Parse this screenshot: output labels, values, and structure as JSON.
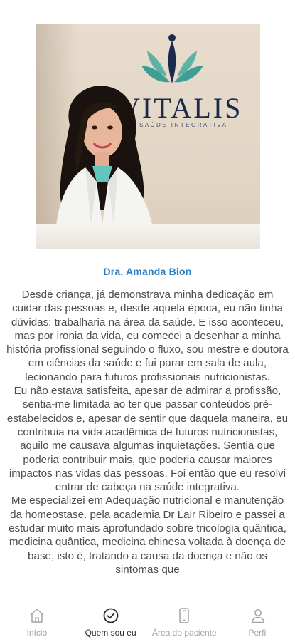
{
  "profile": {
    "name": "Dra. Amanda Bion",
    "clinic_logo": {
      "name": "VITALIS",
      "tagline": "SAÚDE INTEGRATIVA"
    },
    "bio": [
      "Desde criança, já demonstrava minha dedicação em cuidar das pessoas e, desde aquela época, eu não tinha dúvidas: trabalharia na área da saúde. E isso aconteceu, mas por ironia da vida, eu comecei a desenhar a minha história profissional seguindo o fluxo, sou mestre e doutora em ciências da saúde e fui parar em sala de aula, lecionando para futuros profissionais nutricionistas.",
      "Eu não estava satisfeita, apesar de admirar a profissão, sentia-me limitada ao ter que passar conteúdos pré-estabelecidos e, apesar de sentir que daquela maneira, eu contribuia na vida acadêmica de futuros nutricionistas, aquilo me causava algumas inquietações. Sentia que poderia contribuir mais, que poderia causar maiores impactos nas vidas das pessoas. Foi então que eu resolvi entrar de cabeça na saúde integrativa.",
      "Me especializei em Adequação nutricional e manutenção da homeostase. pela academia Dr Lair Ribeiro e passei a estudar muito mais aprofundado sobre tricologia quântica, medicina quântica, medicina chinesa voltada à doença de base, isto é, tratando a causa da doença e não os sintomas que"
    ]
  },
  "tabbar": {
    "items": [
      {
        "label": "Início",
        "icon": "home-icon",
        "active": false
      },
      {
        "label": "Quem sou eu",
        "icon": "check-circle-icon",
        "active": true
      },
      {
        "label": "Área do paciente",
        "icon": "phone-icon",
        "active": false
      },
      {
        "label": "Perfil",
        "icon": "user-icon",
        "active": false
      }
    ]
  },
  "colors": {
    "accent": "#2a7fc4",
    "tab_active": "#2b2b2b",
    "tab_inactive": "#a3a3a3",
    "logo_navy": "#1b2a4a",
    "logo_teal": "#3f9d93"
  }
}
